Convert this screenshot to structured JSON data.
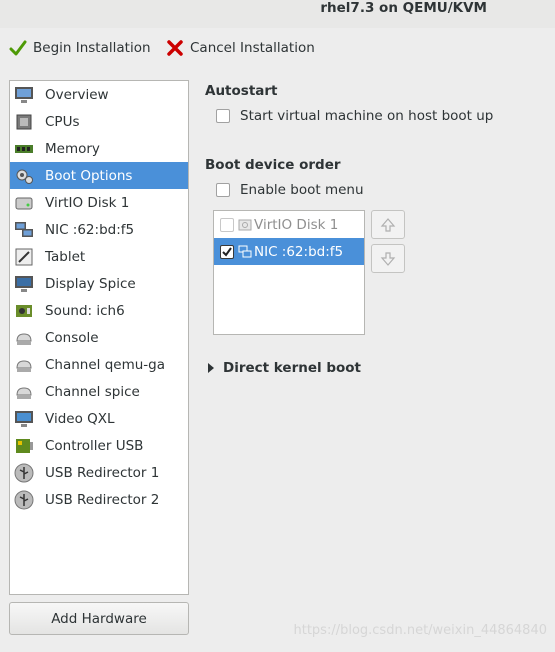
{
  "window": {
    "title": "rhel7.3 on QEMU/KVM"
  },
  "toolbar": {
    "begin_label": "Begin Installation",
    "cancel_label": "Cancel Installation"
  },
  "sidebar": {
    "items": [
      {
        "label": "Overview",
        "icon": "monitor-icon"
      },
      {
        "label": "CPUs",
        "icon": "cpu-icon"
      },
      {
        "label": "Memory",
        "icon": "memory-icon"
      },
      {
        "label": "Boot Options",
        "icon": "boot-gears-icon",
        "selected": true
      },
      {
        "label": "VirtIO Disk 1",
        "icon": "disk-icon"
      },
      {
        "label": "NIC :62:bd:f5",
        "icon": "network-icon"
      },
      {
        "label": "Tablet",
        "icon": "tablet-icon"
      },
      {
        "label": "Display Spice",
        "icon": "display-icon"
      },
      {
        "label": "Sound: ich6",
        "icon": "sound-card-icon"
      },
      {
        "label": "Console",
        "icon": "serial-icon"
      },
      {
        "label": "Channel qemu-ga",
        "icon": "channel-icon"
      },
      {
        "label": "Channel spice",
        "icon": "channel-icon"
      },
      {
        "label": "Video QXL",
        "icon": "video-icon"
      },
      {
        "label": "Controller USB",
        "icon": "controller-icon"
      },
      {
        "label": "USB Redirector 1",
        "icon": "usb-icon"
      },
      {
        "label": "USB Redirector 2",
        "icon": "usb-icon"
      }
    ],
    "add_hardware_label": "Add Hardware"
  },
  "autostart": {
    "heading": "Autostart",
    "checkbox_label": "Start virtual machine on host boot up",
    "checked": false
  },
  "boot": {
    "heading": "Boot device order",
    "enable_menu_label": "Enable boot menu",
    "enable_menu_checked": false,
    "devices": [
      {
        "label": "VirtIO Disk 1",
        "checked": false
      },
      {
        "label": "NIC :62:bd:f5",
        "checked": true
      }
    ]
  },
  "kernel": {
    "label": "Direct kernel boot"
  },
  "watermark": "https://blog.csdn.net/weixin_44864840",
  "colors": {
    "selection": "#4a90d9",
    "background": "#ededed"
  }
}
